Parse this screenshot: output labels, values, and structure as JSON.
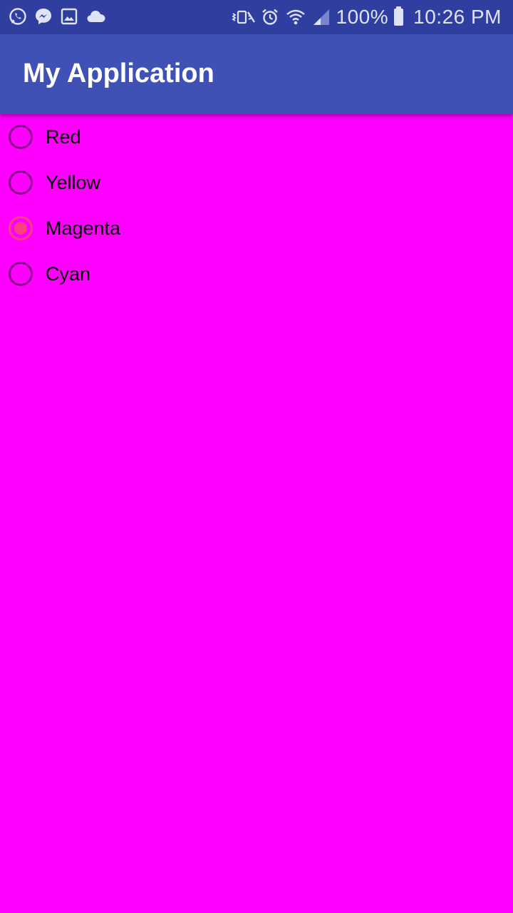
{
  "status_bar": {
    "left_icons": [
      "whatsapp-icon",
      "messenger-icon",
      "gallery-icon",
      "cloud-icon"
    ],
    "right_icons": [
      "vibrate-mute-icon",
      "alarm-icon",
      "wifi-icon",
      "signal-icon"
    ],
    "battery_text": "100%",
    "time": "10:26 PM",
    "background": "#303f9f"
  },
  "app_bar": {
    "title": "My Application",
    "background": "#3f51b5"
  },
  "content": {
    "background": "#ff00ff",
    "radio_group": {
      "selected": "Magenta",
      "options": [
        {
          "label": "Red",
          "checked": false
        },
        {
          "label": "Yellow",
          "checked": false
        },
        {
          "label": "Magenta",
          "checked": true
        },
        {
          "label": "Cyan",
          "checked": false
        }
      ],
      "accent_color": "#ff4081",
      "unchecked_color": "#8a0a8e"
    }
  }
}
